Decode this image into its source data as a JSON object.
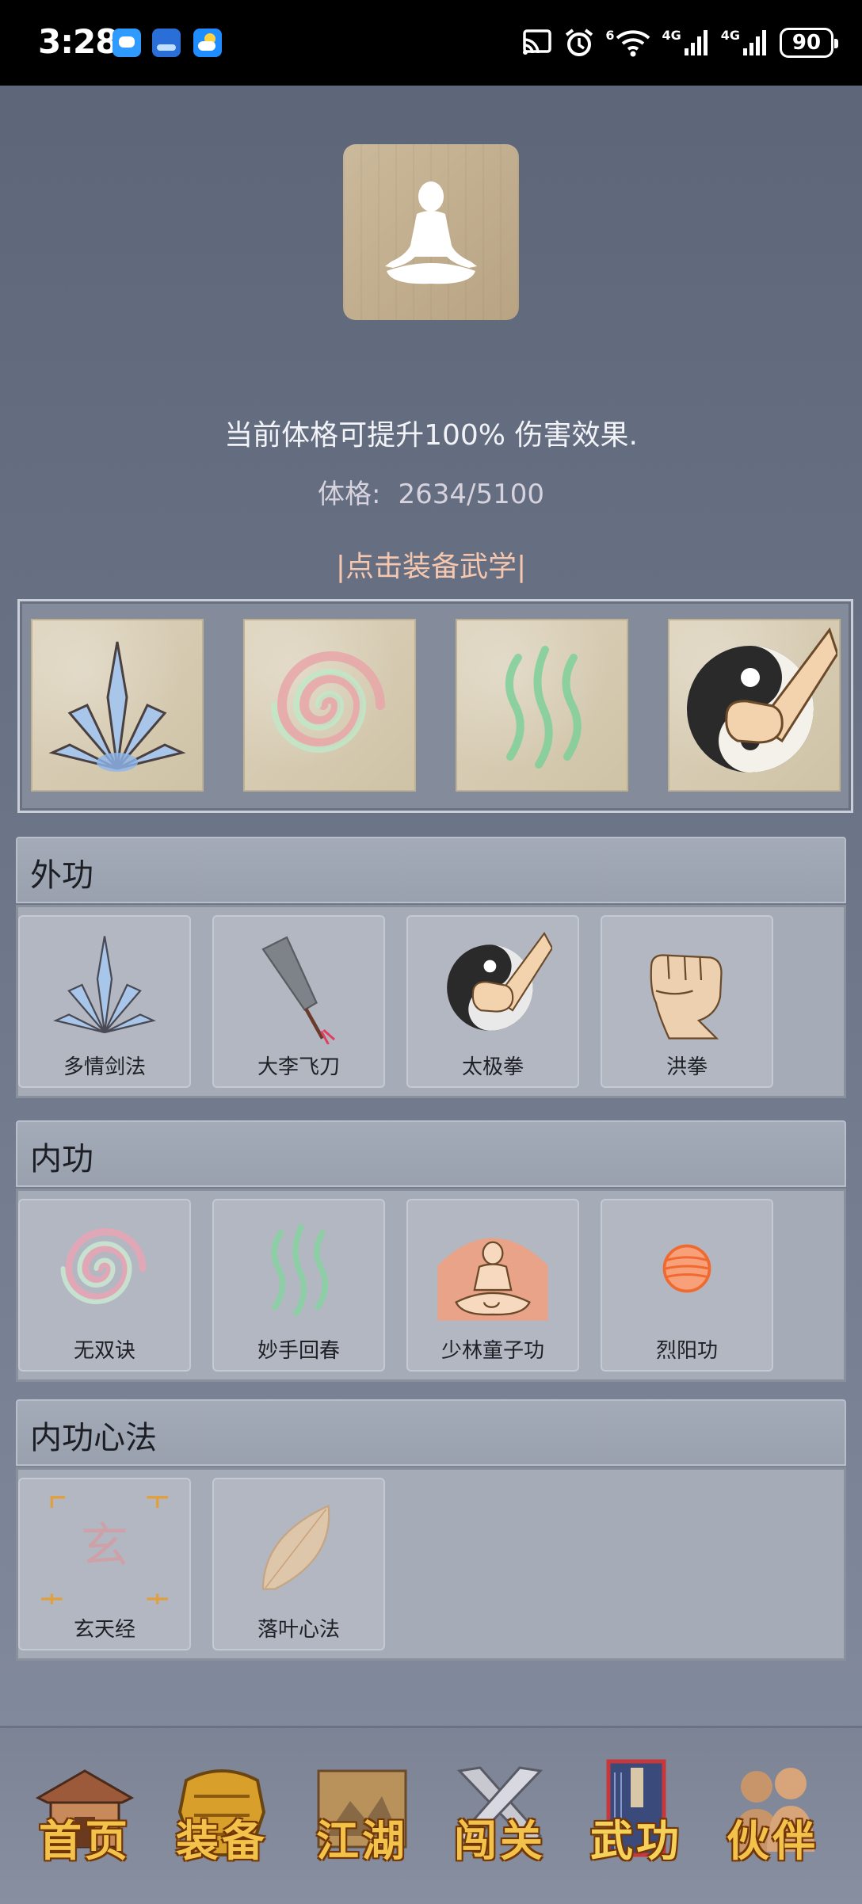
{
  "status_bar": {
    "time": "3:28",
    "signal_label_1": "4G",
    "signal_label_2": "4G",
    "wifi_label": "6",
    "battery": "90"
  },
  "hero": {
    "description": "当前体格可提升100% 伤害效果.",
    "stat_label": "体格:",
    "stat_value": "2634/5100",
    "equip_link": "|点击装备武学|"
  },
  "equipped_slots": [
    {
      "icon": "crystal-blades-icon"
    },
    {
      "icon": "swirl-icon"
    },
    {
      "icon": "green-wisps-icon"
    },
    {
      "icon": "taiji-fist-icon"
    }
  ],
  "categories": {
    "waigong": {
      "title": "外功",
      "skills": [
        {
          "name": "多情剑法",
          "icon": "crystal-blades-icon"
        },
        {
          "name": "大李飞刀",
          "icon": "flying-knife-icon"
        },
        {
          "name": "太极拳",
          "icon": "taiji-fist-icon"
        },
        {
          "name": "洪拳",
          "icon": "fist-icon"
        }
      ]
    },
    "neigong": {
      "title": "内功",
      "skills": [
        {
          "name": "无双诀",
          "icon": "swirl-icon"
        },
        {
          "name": "妙手回春",
          "icon": "green-wisps-icon"
        },
        {
          "name": "少林童子功",
          "icon": "meditating-monk-icon"
        },
        {
          "name": "烈阳功",
          "icon": "sun-orb-icon"
        }
      ]
    },
    "xinfa": {
      "title": "内功心法",
      "skills": [
        {
          "name": "玄天经",
          "icon": "xuan-glyph-icon",
          "glyph": "玄"
        },
        {
          "name": "落叶心法",
          "icon": "leaf-icon"
        }
      ]
    }
  },
  "bottom_nav": [
    {
      "label": "首页",
      "icon": "pavilion-icon"
    },
    {
      "label": "装备",
      "icon": "armor-icon"
    },
    {
      "label": "江湖",
      "icon": "scroll-map-icon"
    },
    {
      "label": "闯关",
      "icon": "crossed-swords-icon"
    },
    {
      "label": "武功",
      "icon": "manual-book-icon",
      "active": true
    },
    {
      "label": "伙伴",
      "icon": "companions-icon"
    }
  ],
  "colors": {
    "background": "#6a7286",
    "equip_link": "#f5c7ae",
    "nav_label": "#f2c24a"
  }
}
